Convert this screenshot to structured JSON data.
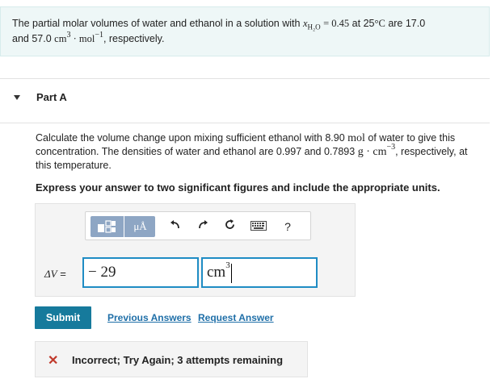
{
  "problem": {
    "text_before": "The partial molar volumes of water and ethanol in a solution with",
    "x_symbol": "x",
    "x_subscript": "H₂O",
    "equals": "= 0.45",
    "at": "at 25",
    "temp_unit": "°C",
    "are": "are 17.0",
    "line2_start": "and 57.0",
    "unit_cm": "cm",
    "unit_exp3": "3",
    "unit_mol": "mol",
    "unit_exp_neg1": "−1",
    "line2_end": ", respectively."
  },
  "part": {
    "title": "Part A"
  },
  "question": {
    "line1a": "Calculate the volume change upon mixing sufficient ethanol with 8.90",
    "line1_unit": "mol",
    "line1b": "of water to give this",
    "line2a": "concentration. The densities of water and ethanol are 0.997 and 0.7893",
    "unit_g": "g",
    "unit_cm": "cm",
    "unit_exp": "−3",
    "line2b": ", respectively, at",
    "line3": "this temperature."
  },
  "instruction": "Express your answer to two significant figures and include the appropriate units.",
  "answer": {
    "label_symbol": "ΔV",
    "label_eq": "=",
    "value": "− 29",
    "unit_base": "cm",
    "unit_exp": "3"
  },
  "toolbar": {
    "units_label": "μÅ",
    "help_label": "?"
  },
  "actions": {
    "submit_label": "Submit",
    "previous_answers": "Previous Answers",
    "request_answer": "Request Answer"
  },
  "feedback": {
    "text": "Incorrect; Try Again; 3 attempts remaining"
  },
  "colors": {
    "accent": "#1f8cc4",
    "submit": "#167a9c",
    "link": "#1f6fa8",
    "error": "#c0392b",
    "problem_bg": "#eef7f7"
  }
}
